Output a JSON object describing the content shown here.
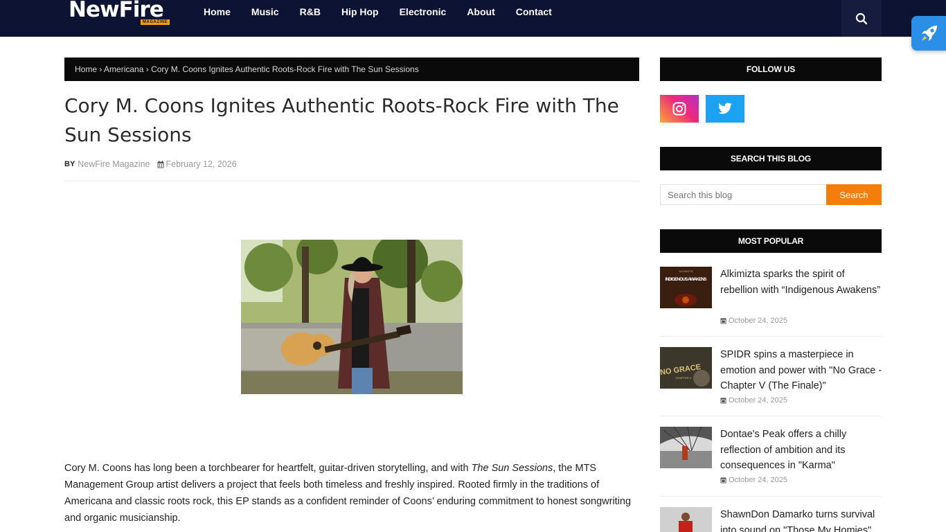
{
  "header": {
    "logo_text": "NewFire",
    "logo_sub": "MAGAZINE",
    "nav": [
      "Home",
      "Music",
      "R&B",
      "Hip Hop",
      "Electronic",
      "About",
      "Contact"
    ],
    "search_icon": "search-icon",
    "rocket_icon": "rocket-icon"
  },
  "breadcrumb": {
    "home": "Home",
    "sep": "›",
    "category": "Americana",
    "current": "Cory M. Coons Ignites Authentic Roots-Rock Fire with The Sun Sessions"
  },
  "post": {
    "title": "Cory M. Coons Ignites Authentic Roots-Rock Fire with The Sun Sessions",
    "by_label": "BY",
    "author": "NewFire Magazine",
    "date": "February 12, 2026",
    "body_part1": "Cory M. Coons has long been a torchbearer for heartfelt, guitar-driven storytelling, and with ",
    "body_em": "The Sun Sessions",
    "body_part2": ", the MTS Management Group artist delivers a project that feels both timeless and freshly inspired. Rooted firmly in the traditions of Americana and classic roots rock, this EP stands as a confident reminder of Coons’ enduring commitment to honest songwriting and organic musicianship."
  },
  "sidebar": {
    "follow_title": "FOLLOW US",
    "search_title": "SEARCH THIS BLOG",
    "search_placeholder": "Search this blog",
    "search_button": "Search",
    "popular_title": "MOST POPULAR",
    "popular": [
      {
        "title": "Alkimizta sparks the spirit of rebellion with “Indigenous Awakens”",
        "date": "October 24, 2025",
        "thumb_text_top": "ALKIMIZTA",
        "thumb_text": "INDIGENOUS AWAKENS"
      },
      {
        "title": "SPIDR spins a masterpiece in emotion and power with \"No Grace - Chapter V (The Finale)\"",
        "date": "October 24, 2025",
        "thumb_text": "NO GRACE",
        "thumb_text_sub": "CHAPTER V"
      },
      {
        "title": "Dontae's Peak offers a chilly reflection of ambition and its consequences in \"Karma\"",
        "date": "October 24, 2025"
      },
      {
        "title": "ShawnDon Damarko turns survival into sound on \"Those My Homies\"",
        "date": ""
      }
    ]
  },
  "colors": {
    "header_bg": "#0d1433",
    "accent_orange": "#f57d0a",
    "section_bg": "#0a0a0a",
    "rocket_blue": "#2b8fe8",
    "twitter_blue": "#1da1f2"
  }
}
